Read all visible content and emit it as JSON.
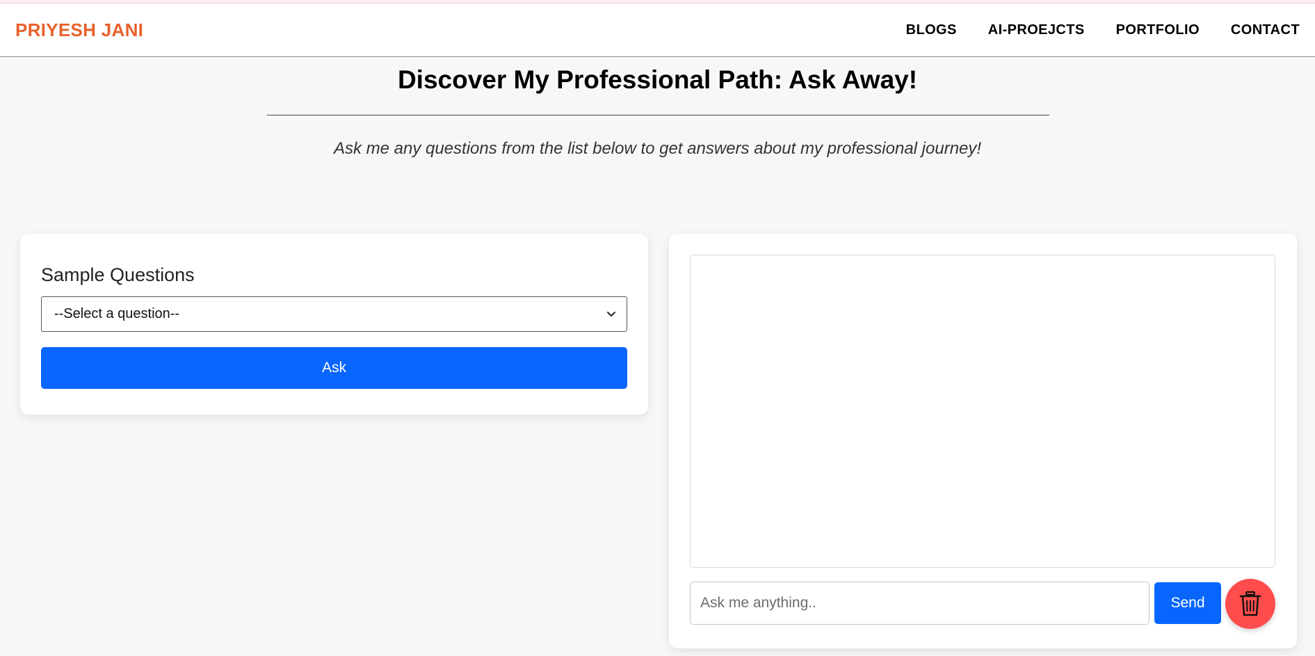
{
  "header": {
    "brand": "PRIYESH JANI",
    "nav": [
      "BLOGS",
      "AI-PROEJCTS",
      "PORTFOLIO",
      "CONTACT"
    ]
  },
  "main": {
    "title": "Discover My Professional Path: Ask Away!",
    "subtitle": "Ask me any questions from the list below to get answers about my professional journey!"
  },
  "questions_panel": {
    "label": "Sample Questions",
    "select_value": "--Select a question--",
    "ask_label": "Ask"
  },
  "chat_panel": {
    "input_placeholder": "Ask me anything..",
    "send_label": "Send",
    "clear_icon": "trash-icon"
  },
  "colors": {
    "brand": "#e8612c",
    "primary": "#0866ff",
    "danger": "#ff4d4d",
    "background": "#f6f7f9"
  }
}
